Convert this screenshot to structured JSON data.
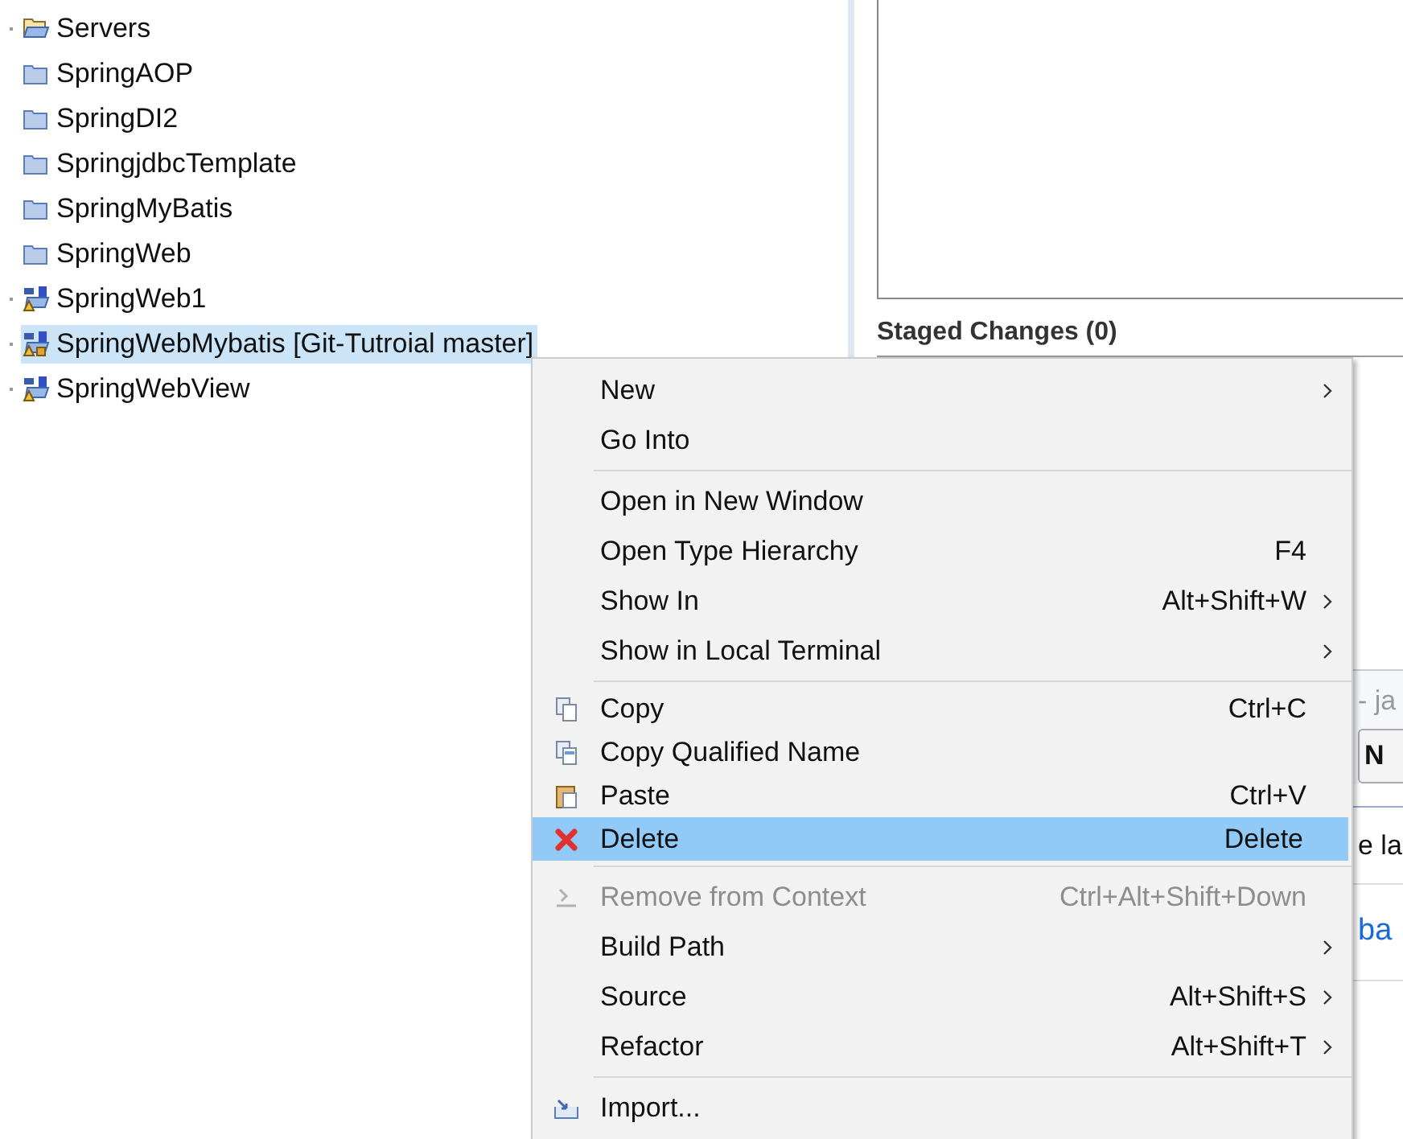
{
  "tree": {
    "items": [
      {
        "label": "Servers",
        "kind": "open-folder",
        "expandable": true,
        "selected": false
      },
      {
        "label": "SpringAOP",
        "kind": "folder",
        "expandable": false,
        "selected": false
      },
      {
        "label": "SpringDI2",
        "kind": "folder",
        "expandable": false,
        "selected": false
      },
      {
        "label": "SpringjdbcTemplate",
        "kind": "folder",
        "expandable": false,
        "selected": false
      },
      {
        "label": "SpringMyBatis",
        "kind": "folder",
        "expandable": false,
        "selected": false
      },
      {
        "label": "SpringWeb",
        "kind": "folder",
        "expandable": false,
        "selected": false
      },
      {
        "label": "SpringWeb1",
        "kind": "maven",
        "expandable": true,
        "selected": false
      },
      {
        "label": "SpringWebMybatis [Git-Tutroial master]",
        "kind": "maven-git",
        "expandable": true,
        "selected": true
      },
      {
        "label": "SpringWebView",
        "kind": "maven",
        "expandable": true,
        "selected": false
      }
    ]
  },
  "git_panel": {
    "staged_title": "Staged Changes (0)",
    "fragment_1": "- ja",
    "button_fragment": "N",
    "fragment_2": "e la",
    "link_fragment": "ba"
  },
  "context_menu": {
    "sections": [
      [
        {
          "label": "New",
          "submenu": true,
          "selected": false,
          "disabled": false
        },
        {
          "label": "Go Into",
          "submenu": false,
          "selected": false,
          "disabled": false
        }
      ],
      [
        {
          "label": "Open in New Window",
          "submenu": false,
          "selected": false,
          "disabled": false
        },
        {
          "label": "Open Type Hierarchy",
          "shortcut": "F4",
          "submenu": false,
          "selected": false,
          "disabled": false
        },
        {
          "label": "Show In",
          "shortcut": "Alt+Shift+W",
          "submenu": true,
          "selected": false,
          "disabled": false
        },
        {
          "label": "Show in Local Terminal",
          "submenu": true,
          "selected": false,
          "disabled": false
        }
      ],
      [
        {
          "label": "Copy",
          "kind": "copy",
          "shortcut": "Ctrl+C",
          "submenu": false,
          "selected": false,
          "disabled": false
        },
        {
          "label": "Copy Qualified Name",
          "kind": "copy-name",
          "submenu": false,
          "selected": false,
          "disabled": false
        },
        {
          "label": "Paste",
          "kind": "paste",
          "shortcut": "Ctrl+V",
          "submenu": false,
          "selected": false,
          "disabled": false
        },
        {
          "label": "Delete",
          "kind": "delete",
          "shortcut": "Delete",
          "submenu": false,
          "selected": true,
          "disabled": false
        }
      ],
      [
        {
          "label": "Remove from Context",
          "kind": "remove",
          "shortcut": "Ctrl+Alt+Shift+Down",
          "submenu": false,
          "selected": false,
          "disabled": true
        },
        {
          "label": "Build Path",
          "submenu": true,
          "selected": false,
          "disabled": false
        },
        {
          "label": "Source",
          "shortcut": "Alt+Shift+S",
          "submenu": true,
          "selected": false,
          "disabled": false
        },
        {
          "label": "Refactor",
          "shortcut": "Alt+Shift+T",
          "submenu": true,
          "selected": false,
          "disabled": false
        }
      ],
      [
        {
          "label": "Import...",
          "kind": "import",
          "submenu": false,
          "selected": false,
          "disabled": false
        }
      ]
    ]
  }
}
